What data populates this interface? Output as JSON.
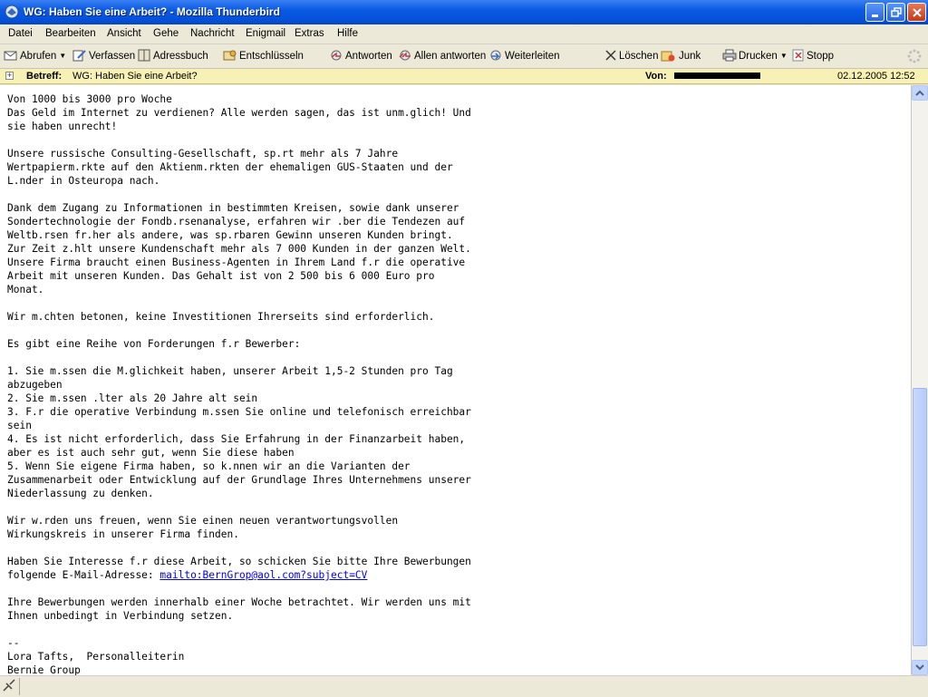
{
  "window": {
    "title": "WG: Haben Sie eine Arbeit? - Mozilla Thunderbird"
  },
  "menu": [
    "Datei",
    "Bearbeiten",
    "Ansicht",
    "Gehe",
    "Nachricht",
    "Enigmail",
    "Extras",
    "Hilfe"
  ],
  "toolbar": {
    "abrufen": "Abrufen",
    "verfassen": "Verfassen",
    "adressbuch": "Adressbuch",
    "entschluesseln": "Entschlüsseln",
    "antworten": "Antworten",
    "allen_antworten": "Allen antworten",
    "weiterleiten": "Weiterleiten",
    "loeschen": "Löschen",
    "junk": "Junk",
    "drucken": "Drucken",
    "stopp": "Stopp"
  },
  "header": {
    "subject_label": "Betreff:",
    "subject": "WG: Haben Sie eine Arbeit?",
    "from_label": "Von:",
    "date": "02.12.2005 12:52"
  },
  "message": {
    "body_before_link": "Von 1000 bis 3000 pro Woche\nDas Geld im Internet zu verdienen? Alle werden sagen, das ist unm.glich! Und\nsie haben unrecht!\n\nUnsere russische Consulting-Gesellschaft, sp.rt mehr als 7 Jahre\nWertpapierm.rkte auf den Aktienm.rkten der ehemaligen GUS-Staaten und der\nL.nder in Osteuropa nach.\n\nDank dem Zugang zu Informationen in bestimmten Kreisen, sowie dank unserer\nSondertechnologie der Fondb.rsenanalyse, erfahren wir .ber die Tendezen auf\nWeltb.rsen fr.her als andere, was sp.rbaren Gewinn unseren Kunden bringt.\nZur Zeit z.hlt unsere Kundenschaft mehr als 7 000 Kunden in der ganzen Welt.\nUnsere Firma braucht einen Business-Agenten in Ihrem Land f.r die operative\nArbeit mit unseren Kunden. Das Gehalt ist von 2 500 bis 6 000 Euro pro\nMonat.\n\nWir m.chten betonen, keine Investitionen Ihrerseits sind erforderlich.\n\nEs gibt eine Reihe von Forderungen f.r Bewerber:\n\n1. Sie m.ssen die M.glichkeit haben, unserer Arbeit 1,5-2 Stunden pro Tag\nabzugeben\n2. Sie m.ssen .lter als 20 Jahre alt sein\n3. F.r die operative Verbindung m.ssen Sie online und telefonisch erreichbar\nsein\n4. Es ist nicht erforderlich, dass Sie Erfahrung in der Finanzarbeit haben,\naber es ist auch sehr gut, wenn Sie diese haben\n5. Wenn Sie eigene Firma haben, so k.nnen wir an die Varianten der\nZusammenarbeit oder Entwicklung auf der Grundlage Ihres Unternehmens unserer\nNiederlassung zu denken.\n\nWir w.rden uns freuen, wenn Sie einen neuen verantwortungsvollen\nWirkungskreis in unserer Firma finden.\n\nHaben Sie Interesse f.r diese Arbeit, so schicken Sie bitte Ihre Bewerbungen\nfolgende E-Mail-Adresse: ",
    "link": "mailto:BernGrop@aol.com?subject=CV",
    "body_after_link": "\n\nIhre Bewerbungen werden innerhalb einer Woche betrachtet. Wir werden uns mit\nIhnen unbedingt in Verbindung setzen.\n\n--\nLora Tafts,  Personalleiterin\nBernie Group"
  },
  "status": {
    "text": ""
  },
  "colors": {
    "titlebar": "#0a5ae3",
    "header_bg": "#f7f1b5",
    "link": "#0000ee",
    "chrome": "#ece9d8"
  },
  "icons": [
    "thunderbird-icon",
    "minimize-icon",
    "maximize-icon",
    "close-icon",
    "get-mail-icon",
    "compose-icon",
    "addressbook-icon",
    "decrypt-icon",
    "reply-icon",
    "reply-all-icon",
    "forward-icon",
    "delete-icon",
    "junk-icon",
    "print-icon",
    "stop-icon",
    "throbber-icon",
    "expand-icon",
    "online-status-icon"
  ]
}
